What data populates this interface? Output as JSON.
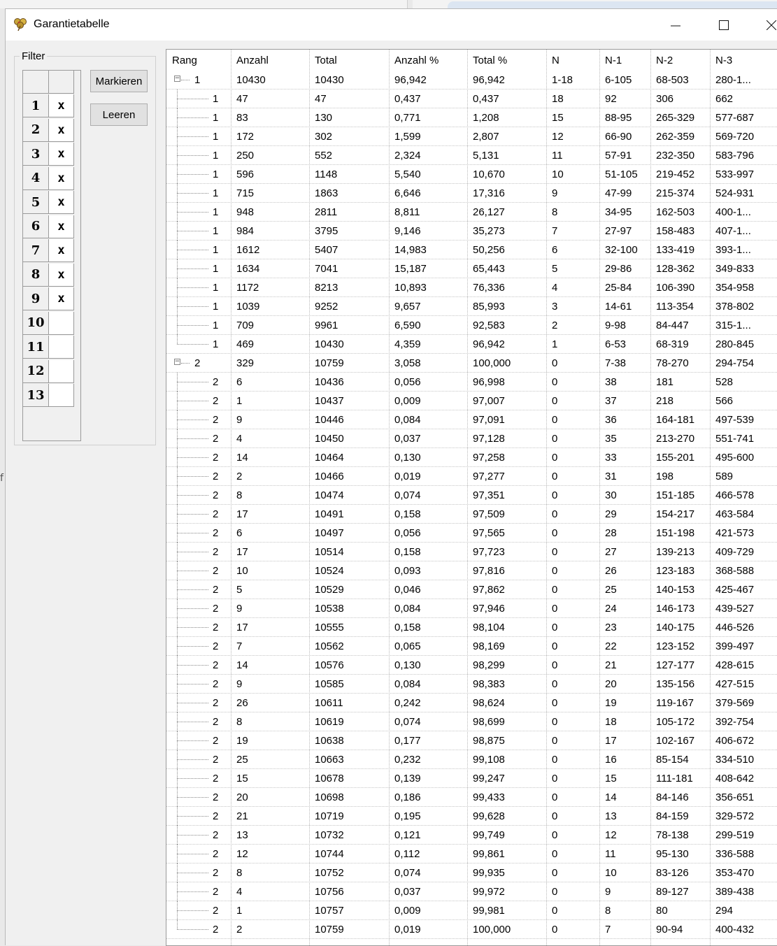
{
  "window": {
    "title": "Garantietabelle"
  },
  "background": {
    "letter": "f"
  },
  "filter": {
    "legend": "Filter",
    "rows": [
      {
        "num": "1",
        "val": "x"
      },
      {
        "num": "2",
        "val": "x"
      },
      {
        "num": "3",
        "val": "x"
      },
      {
        "num": "4",
        "val": "x"
      },
      {
        "num": "5",
        "val": "x"
      },
      {
        "num": "6",
        "val": "x"
      },
      {
        "num": "7",
        "val": "x"
      },
      {
        "num": "8",
        "val": "x"
      },
      {
        "num": "9",
        "val": "x"
      },
      {
        "num": "10",
        "val": ""
      },
      {
        "num": "11",
        "val": ""
      },
      {
        "num": "12",
        "val": ""
      },
      {
        "num": "13",
        "val": ""
      }
    ],
    "mark_label": "Markieren",
    "clear_label": "Leeren"
  },
  "table": {
    "columns": [
      "Rang",
      "Anzahl",
      "Total",
      "Anzahl %",
      "Total %",
      "N",
      "N-1",
      "N-2",
      "N-3"
    ],
    "rows": [
      {
        "level": 0,
        "expanded": true,
        "rang": "1",
        "anzahl": "10430",
        "total": "10430",
        "apct": "96,942",
        "tpct": "96,942",
        "n": "1-18",
        "n1": "6-105",
        "n2": "68-503",
        "n3": "280-1..."
      },
      {
        "level": 1,
        "last": false,
        "rang": "1",
        "anzahl": "47",
        "total": "47",
        "apct": "0,437",
        "tpct": "0,437",
        "n": "18",
        "n1": "92",
        "n2": "306",
        "n3": "662"
      },
      {
        "level": 1,
        "last": false,
        "rang": "1",
        "anzahl": "83",
        "total": "130",
        "apct": "0,771",
        "tpct": "1,208",
        "n": "15",
        "n1": "88-95",
        "n2": "265-329",
        "n3": "577-687"
      },
      {
        "level": 1,
        "last": false,
        "rang": "1",
        "anzahl": "172",
        "total": "302",
        "apct": "1,599",
        "tpct": "2,807",
        "n": "12",
        "n1": "66-90",
        "n2": "262-359",
        "n3": "569-720"
      },
      {
        "level": 1,
        "last": false,
        "rang": "1",
        "anzahl": "250",
        "total": "552",
        "apct": "2,324",
        "tpct": "5,131",
        "n": "11",
        "n1": "57-91",
        "n2": "232-350",
        "n3": "583-796"
      },
      {
        "level": 1,
        "last": false,
        "rang": "1",
        "anzahl": "596",
        "total": "1148",
        "apct": "5,540",
        "tpct": "10,670",
        "n": "10",
        "n1": "51-105",
        "n2": "219-452",
        "n3": "533-997"
      },
      {
        "level": 1,
        "last": false,
        "rang": "1",
        "anzahl": "715",
        "total": "1863",
        "apct": "6,646",
        "tpct": "17,316",
        "n": "9",
        "n1": "47-99",
        "n2": "215-374",
        "n3": "524-931"
      },
      {
        "level": 1,
        "last": false,
        "rang": "1",
        "anzahl": "948",
        "total": "2811",
        "apct": "8,811",
        "tpct": "26,127",
        "n": "8",
        "n1": "34-95",
        "n2": "162-503",
        "n3": "400-1..."
      },
      {
        "level": 1,
        "last": false,
        "rang": "1",
        "anzahl": "984",
        "total": "3795",
        "apct": "9,146",
        "tpct": "35,273",
        "n": "7",
        "n1": "27-97",
        "n2": "158-483",
        "n3": "407-1..."
      },
      {
        "level": 1,
        "last": false,
        "rang": "1",
        "anzahl": "1612",
        "total": "5407",
        "apct": "14,983",
        "tpct": "50,256",
        "n": "6",
        "n1": "32-100",
        "n2": "133-419",
        "n3": "393-1..."
      },
      {
        "level": 1,
        "last": false,
        "rang": "1",
        "anzahl": "1634",
        "total": "7041",
        "apct": "15,187",
        "tpct": "65,443",
        "n": "5",
        "n1": "29-86",
        "n2": "128-362",
        "n3": "349-833"
      },
      {
        "level": 1,
        "last": false,
        "rang": "1",
        "anzahl": "1172",
        "total": "8213",
        "apct": "10,893",
        "tpct": "76,336",
        "n": "4",
        "n1": "25-84",
        "n2": "106-390",
        "n3": "354-958"
      },
      {
        "level": 1,
        "last": false,
        "rang": "1",
        "anzahl": "1039",
        "total": "9252",
        "apct": "9,657",
        "tpct": "85,993",
        "n": "3",
        "n1": "14-61",
        "n2": "113-354",
        "n3": "378-802"
      },
      {
        "level": 1,
        "last": false,
        "rang": "1",
        "anzahl": "709",
        "total": "9961",
        "apct": "6,590",
        "tpct": "92,583",
        "n": "2",
        "n1": "9-98",
        "n2": "84-447",
        "n3": "315-1..."
      },
      {
        "level": 1,
        "last": true,
        "rang": "1",
        "anzahl": "469",
        "total": "10430",
        "apct": "4,359",
        "tpct": "96,942",
        "n": "1",
        "n1": "6-53",
        "n2": "68-319",
        "n3": "280-845"
      },
      {
        "level": 0,
        "expanded": true,
        "rang": "2",
        "anzahl": "329",
        "total": "10759",
        "apct": "3,058",
        "tpct": "100,000",
        "n": "0",
        "n1": "7-38",
        "n2": "78-270",
        "n3": "294-754"
      },
      {
        "level": 1,
        "last": false,
        "rang": "2",
        "anzahl": "6",
        "total": "10436",
        "apct": "0,056",
        "tpct": "96,998",
        "n": "0",
        "n1": "38",
        "n2": "181",
        "n3": "528"
      },
      {
        "level": 1,
        "last": false,
        "rang": "2",
        "anzahl": "1",
        "total": "10437",
        "apct": "0,009",
        "tpct": "97,007",
        "n": "0",
        "n1": "37",
        "n2": "218",
        "n3": "566"
      },
      {
        "level": 1,
        "last": false,
        "rang": "2",
        "anzahl": "9",
        "total": "10446",
        "apct": "0,084",
        "tpct": "97,091",
        "n": "0",
        "n1": "36",
        "n2": "164-181",
        "n3": "497-539"
      },
      {
        "level": 1,
        "last": false,
        "rang": "2",
        "anzahl": "4",
        "total": "10450",
        "apct": "0,037",
        "tpct": "97,128",
        "n": "0",
        "n1": "35",
        "n2": "213-270",
        "n3": "551-741"
      },
      {
        "level": 1,
        "last": false,
        "rang": "2",
        "anzahl": "14",
        "total": "10464",
        "apct": "0,130",
        "tpct": "97,258",
        "n": "0",
        "n1": "33",
        "n2": "155-201",
        "n3": "495-600"
      },
      {
        "level": 1,
        "last": false,
        "rang": "2",
        "anzahl": "2",
        "total": "10466",
        "apct": "0,019",
        "tpct": "97,277",
        "n": "0",
        "n1": "31",
        "n2": "198",
        "n3": "589"
      },
      {
        "level": 1,
        "last": false,
        "rang": "2",
        "anzahl": "8",
        "total": "10474",
        "apct": "0,074",
        "tpct": "97,351",
        "n": "0",
        "n1": "30",
        "n2": "151-185",
        "n3": "466-578"
      },
      {
        "level": 1,
        "last": false,
        "rang": "2",
        "anzahl": "17",
        "total": "10491",
        "apct": "0,158",
        "tpct": "97,509",
        "n": "0",
        "n1": "29",
        "n2": "154-217",
        "n3": "463-584"
      },
      {
        "level": 1,
        "last": false,
        "rang": "2",
        "anzahl": "6",
        "total": "10497",
        "apct": "0,056",
        "tpct": "97,565",
        "n": "0",
        "n1": "28",
        "n2": "151-198",
        "n3": "421-573"
      },
      {
        "level": 1,
        "last": false,
        "rang": "2",
        "anzahl": "17",
        "total": "10514",
        "apct": "0,158",
        "tpct": "97,723",
        "n": "0",
        "n1": "27",
        "n2": "139-213",
        "n3": "409-729"
      },
      {
        "level": 1,
        "last": false,
        "rang": "2",
        "anzahl": "10",
        "total": "10524",
        "apct": "0,093",
        "tpct": "97,816",
        "n": "0",
        "n1": "26",
        "n2": "123-183",
        "n3": "368-588"
      },
      {
        "level": 1,
        "last": false,
        "rang": "2",
        "anzahl": "5",
        "total": "10529",
        "apct": "0,046",
        "tpct": "97,862",
        "n": "0",
        "n1": "25",
        "n2": "140-153",
        "n3": "425-467"
      },
      {
        "level": 1,
        "last": false,
        "rang": "2",
        "anzahl": "9",
        "total": "10538",
        "apct": "0,084",
        "tpct": "97,946",
        "n": "0",
        "n1": "24",
        "n2": "146-173",
        "n3": "439-527"
      },
      {
        "level": 1,
        "last": false,
        "rang": "2",
        "anzahl": "17",
        "total": "10555",
        "apct": "0,158",
        "tpct": "98,104",
        "n": "0",
        "n1": "23",
        "n2": "140-175",
        "n3": "446-526"
      },
      {
        "level": 1,
        "last": false,
        "rang": "2",
        "anzahl": "7",
        "total": "10562",
        "apct": "0,065",
        "tpct": "98,169",
        "n": "0",
        "n1": "22",
        "n2": "123-152",
        "n3": "399-497"
      },
      {
        "level": 1,
        "last": false,
        "rang": "2",
        "anzahl": "14",
        "total": "10576",
        "apct": "0,130",
        "tpct": "98,299",
        "n": "0",
        "n1": "21",
        "n2": "127-177",
        "n3": "428-615"
      },
      {
        "level": 1,
        "last": false,
        "rang": "2",
        "anzahl": "9",
        "total": "10585",
        "apct": "0,084",
        "tpct": "98,383",
        "n": "0",
        "n1": "20",
        "n2": "135-156",
        "n3": "427-515"
      },
      {
        "level": 1,
        "last": false,
        "rang": "2",
        "anzahl": "26",
        "total": "10611",
        "apct": "0,242",
        "tpct": "98,624",
        "n": "0",
        "n1": "19",
        "n2": "119-167",
        "n3": "379-569"
      },
      {
        "level": 1,
        "last": false,
        "rang": "2",
        "anzahl": "8",
        "total": "10619",
        "apct": "0,074",
        "tpct": "98,699",
        "n": "0",
        "n1": "18",
        "n2": "105-172",
        "n3": "392-754"
      },
      {
        "level": 1,
        "last": false,
        "rang": "2",
        "anzahl": "19",
        "total": "10638",
        "apct": "0,177",
        "tpct": "98,875",
        "n": "0",
        "n1": "17",
        "n2": "102-167",
        "n3": "406-672"
      },
      {
        "level": 1,
        "last": false,
        "rang": "2",
        "anzahl": "25",
        "total": "10663",
        "apct": "0,232",
        "tpct": "99,108",
        "n": "0",
        "n1": "16",
        "n2": "85-154",
        "n3": "334-510"
      },
      {
        "level": 1,
        "last": false,
        "rang": "2",
        "anzahl": "15",
        "total": "10678",
        "apct": "0,139",
        "tpct": "99,247",
        "n": "0",
        "n1": "15",
        "n2": "111-181",
        "n3": "408-642"
      },
      {
        "level": 1,
        "last": false,
        "rang": "2",
        "anzahl": "20",
        "total": "10698",
        "apct": "0,186",
        "tpct": "99,433",
        "n": "0",
        "n1": "14",
        "n2": "84-146",
        "n3": "356-651"
      },
      {
        "level": 1,
        "last": false,
        "rang": "2",
        "anzahl": "21",
        "total": "10719",
        "apct": "0,195",
        "tpct": "99,628",
        "n": "0",
        "n1": "13",
        "n2": "84-159",
        "n3": "329-572"
      },
      {
        "level": 1,
        "last": false,
        "rang": "2",
        "anzahl": "13",
        "total": "10732",
        "apct": "0,121",
        "tpct": "99,749",
        "n": "0",
        "n1": "12",
        "n2": "78-138",
        "n3": "299-519"
      },
      {
        "level": 1,
        "last": false,
        "rang": "2",
        "anzahl": "12",
        "total": "10744",
        "apct": "0,112",
        "tpct": "99,861",
        "n": "0",
        "n1": "11",
        "n2": "95-130",
        "n3": "336-588"
      },
      {
        "level": 1,
        "last": false,
        "rang": "2",
        "anzahl": "8",
        "total": "10752",
        "apct": "0,074",
        "tpct": "99,935",
        "n": "0",
        "n1": "10",
        "n2": "83-126",
        "n3": "353-470"
      },
      {
        "level": 1,
        "last": false,
        "rang": "2",
        "anzahl": "4",
        "total": "10756",
        "apct": "0,037",
        "tpct": "99,972",
        "n": "0",
        "n1": "9",
        "n2": "89-127",
        "n3": "389-438"
      },
      {
        "level": 1,
        "last": false,
        "rang": "2",
        "anzahl": "1",
        "total": "10757",
        "apct": "0,009",
        "tpct": "99,981",
        "n": "0",
        "n1": "8",
        "n2": "80",
        "n3": "294"
      },
      {
        "level": 1,
        "last": true,
        "rang": "2",
        "anzahl": "2",
        "total": "10759",
        "apct": "0,019",
        "tpct": "100,000",
        "n": "0",
        "n1": "7",
        "n2": "90-94",
        "n3": "400-432"
      }
    ]
  },
  "icons": {
    "app": "clover-icon",
    "minimize": "minimize-icon",
    "maximize": "maximize-icon",
    "close": "close-icon"
  }
}
